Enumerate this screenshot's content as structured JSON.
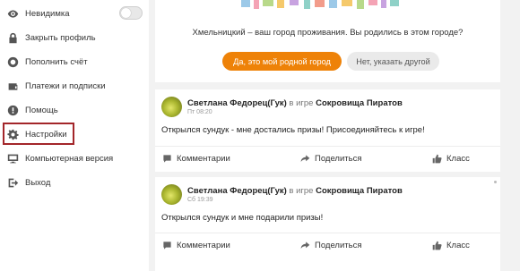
{
  "sidebar": {
    "items": [
      {
        "label": "Невидимка",
        "icon": "eye-icon"
      },
      {
        "label": "Закрыть профиль",
        "icon": "lock-icon"
      },
      {
        "label": "Пополнить счёт",
        "icon": "coin-icon"
      },
      {
        "label": "Платежи и подписки",
        "icon": "wallet-icon"
      },
      {
        "label": "Помощь",
        "icon": "help-icon"
      },
      {
        "label": "Настройки",
        "icon": "gear-icon"
      },
      {
        "label": "Компьютерная версия",
        "icon": "monitor-icon"
      },
      {
        "label": "Выход",
        "icon": "logout-icon"
      }
    ],
    "highlight_color": "#a3262a"
  },
  "city_prompt": {
    "text": "Хмельницкий – ваш город проживания. Вы родились в этом городе?",
    "yes_label": "Да, это мой родной город",
    "no_label": "Нет, указать другой",
    "accent": "#ee8208"
  },
  "posts": [
    {
      "author": "Светлана Федорец(Гук)",
      "in_game": "в игре",
      "game": "Сокровища Пиратов",
      "time": "Пт 08:20",
      "text": "Открылся сундук - мне достались призы! Присоединяйтесь к игре!",
      "comments": "Комментарии",
      "share": "Поделиться",
      "like": "Класс"
    },
    {
      "author": "Светлана Федорец(Гук)",
      "in_game": "в игре",
      "game": "Сокровища Пиратов",
      "time": "Сб 19:39",
      "text": "Открылся сундук и мне подарили призы!",
      "comments": "Комментарии",
      "share": "Поделиться",
      "like": "Класс"
    }
  ]
}
